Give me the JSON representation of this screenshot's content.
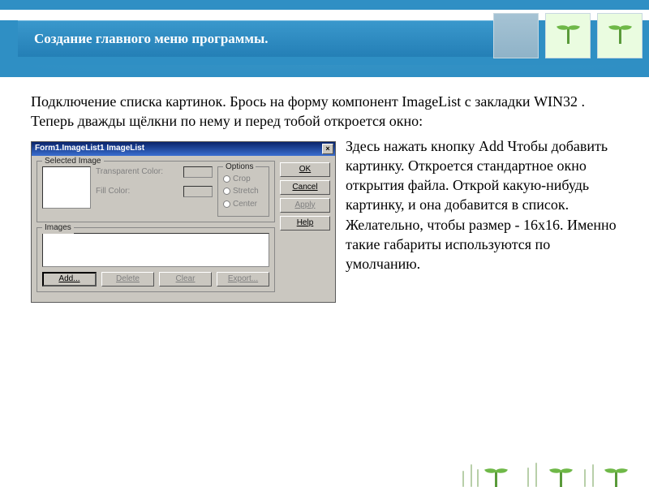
{
  "header": {
    "title": "Создание главного меню программы."
  },
  "intro": "Подключение списка картинок. Брось на форму компонент ImageList с закладки WIN32 . Теперь дважды щёлкни по нему и перед тобой откроется окно:",
  "dialog": {
    "title": "Form1.ImageList1 ImageList",
    "groups": {
      "selected": "Selected Image",
      "options": "Options",
      "images": "Images"
    },
    "labels": {
      "transparent": "Transparent Color:",
      "fill": "Fill Color:"
    },
    "option_items": {
      "crop": "Crop",
      "stretch": "Stretch",
      "center": "Center"
    },
    "image_buttons": {
      "add": "Add...",
      "delete": "Delete",
      "clear": "Clear",
      "export": "Export..."
    },
    "side_buttons": {
      "ok": "OK",
      "cancel": "Cancel",
      "apply": "Apply",
      "help": "Help"
    }
  },
  "after": "Здесь нажать кнопку Add Чтобы добавить картинку. Откроется стандартное окно открытия файла. Открой какую-нибудь картинку, и она добавится в список. Желательно, чтобы размер - 16х16. Именно такие габариты используются по  умолчанию."
}
